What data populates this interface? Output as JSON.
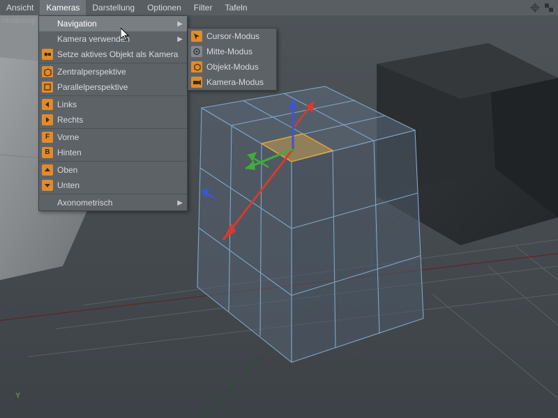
{
  "menubar": {
    "items": [
      "Ansicht",
      "Kameras",
      "Darstellung",
      "Optionen",
      "Filter",
      "Tafeln"
    ],
    "active_index": 1
  },
  "viewport_label": "ntralpersp",
  "menu": {
    "items": [
      {
        "label": "Navigation",
        "icon": null,
        "submenu": true,
        "highlight": true
      },
      {
        "label": "Kamera verwenden",
        "icon": null,
        "submenu": true
      },
      {
        "label": "Setze aktives Objekt als Kamera",
        "icon": "camera-dot"
      },
      {
        "sep": true
      },
      {
        "label": "Zentralperspektive",
        "icon": "persp-cube"
      },
      {
        "label": "Parallelperspektive",
        "icon": "ortho-cube"
      },
      {
        "sep": true
      },
      {
        "label": "Links",
        "icon": "arrow-left"
      },
      {
        "label": "Rechts",
        "icon": "arrow-right"
      },
      {
        "sep": true
      },
      {
        "label": "Vorne",
        "icon": "letter-f"
      },
      {
        "label": "Hinten",
        "icon": "letter-b"
      },
      {
        "sep": true
      },
      {
        "label": "Oben",
        "icon": "arrow-up"
      },
      {
        "label": "Unten",
        "icon": "arrow-down"
      },
      {
        "sep": true
      },
      {
        "label": "Axonometrisch",
        "icon": null,
        "submenu": true
      }
    ]
  },
  "submenu": {
    "items": [
      {
        "label": "Cursor-Modus",
        "icon": "cursor-mode"
      },
      {
        "label": "Mitte-Modus",
        "icon": "center-mode"
      },
      {
        "label": "Objekt-Modus",
        "icon": "object-mode"
      },
      {
        "label": "Kamera-Modus",
        "icon": "camera-mode"
      }
    ]
  },
  "axis_labels": {
    "y": "Y"
  },
  "colors": {
    "accent_orange": "#e08b2c",
    "accent_face": "#c39a4a",
    "axis_x": "#d93a2b",
    "axis_y": "#3fae3b",
    "axis_z": "#3a56d9",
    "wire": "#7fa7c9",
    "bg": "#454a4f"
  }
}
